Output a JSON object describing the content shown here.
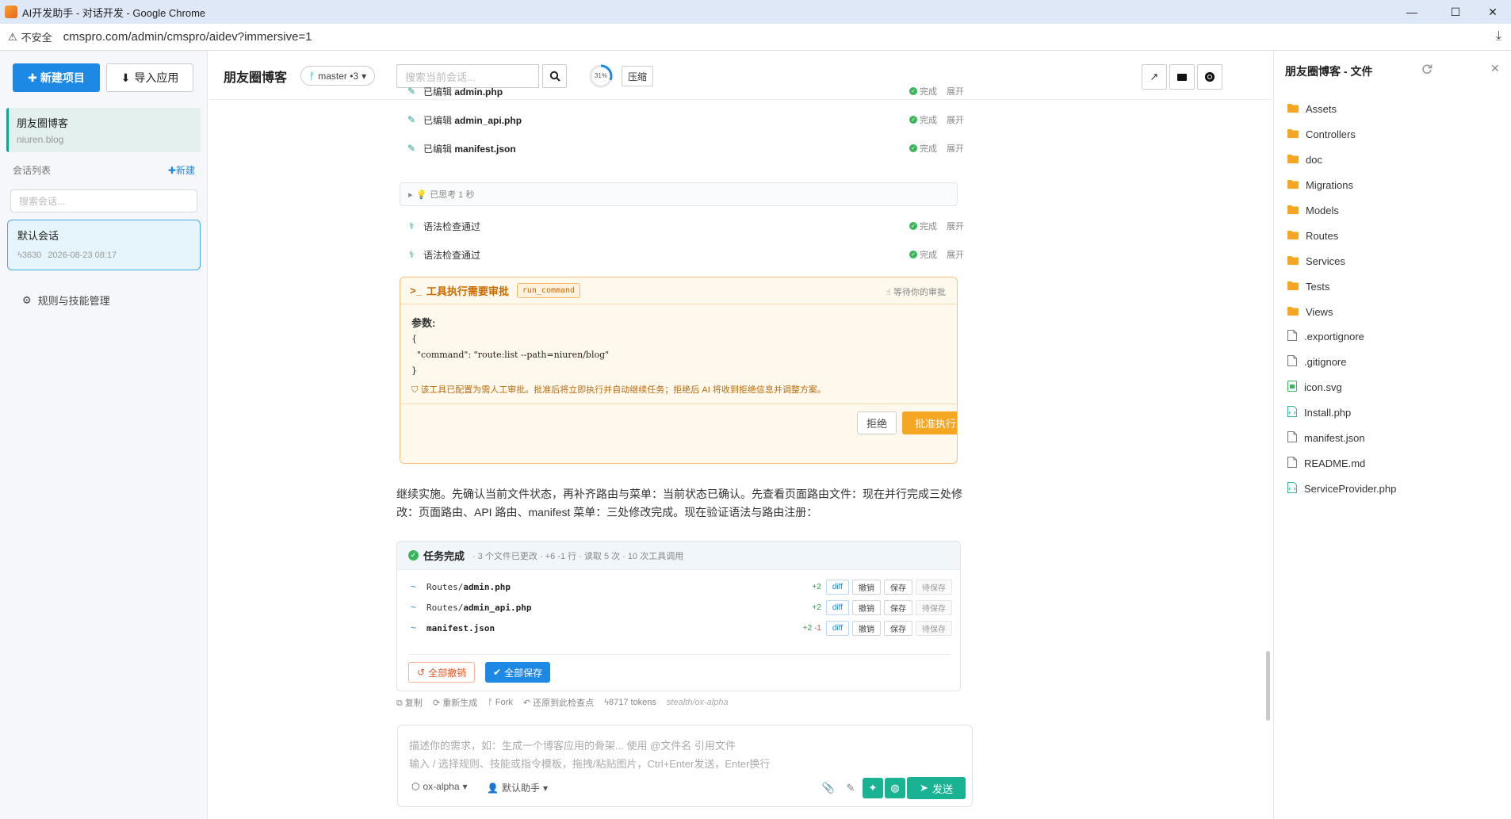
{
  "browser": {
    "title": "AI开发助手 - 对话开发 - Google Chrome",
    "security": "不安全",
    "url": "cmspro.com/admin/cmspro/aidev?immersive=1"
  },
  "sidebar": {
    "new_project": "新建项目",
    "import_app": "导入应用",
    "project": {
      "name": "朋友圈博客",
      "domain": "niuren.blog"
    },
    "conv_list_label": "会话列表",
    "conv_new": "新建",
    "conv_search_placeholder": "搜索会话...",
    "conversation": {
      "title": "默认会话",
      "tokens": "3630",
      "time": "2026-08-23 08:17"
    },
    "rules": "规则与技能管理"
  },
  "topbar": {
    "title": "朋友圈博客",
    "branch": "master •3",
    "search_placeholder": "搜索当前会话...",
    "context_usage": "31%",
    "context_usage_value": 0.31,
    "compress": "压缩"
  },
  "log": {
    "entries": [
      {
        "prefix": "已编辑",
        "file": "admin.php",
        "status": "完成",
        "expand": "展开"
      },
      {
        "prefix": "已编辑",
        "file": "admin_api.php",
        "status": "完成",
        "expand": "展开"
      },
      {
        "prefix": "已编辑",
        "file": "manifest.json",
        "status": "完成",
        "expand": "展开"
      }
    ],
    "thinking": "已思考 1 秒",
    "checks": [
      {
        "text": "语法检查通过",
        "status": "完成",
        "expand": "展开"
      },
      {
        "text": "语法检查通过",
        "status": "完成",
        "expand": "展开"
      }
    ]
  },
  "approval": {
    "title": "工具执行需要审批",
    "tool": "run_command",
    "waiting": "等待你的审批",
    "params_label": "参数:",
    "code_lines": [
      "{",
      "  \"command\": \"route:list --path=niuren/blog\"",
      "}"
    ],
    "note": "该工具已配置为需人工审批。批准后将立即执行并自动继续任务；拒绝后 AI 将收到拒绝信息并调整方案。",
    "reject": "拒绝",
    "approve": "批准执行"
  },
  "prose": {
    "text": "继续实施。先确认当前文件状态，再补齐路由与菜单：当前状态已确认。先查看页面路由文件：现在并行完成三处修改：页面路由、API 路由、manifest 菜单：三处修改完成。现在验证语法与路由注册："
  },
  "task": {
    "title": "任务完成",
    "meta": "· 3 个文件已更改 · +6 -1 行 · 读取 5 次 · 10 次工具调用",
    "files": [
      {
        "dir": "Routes/",
        "name": "admin.php",
        "add": "+2",
        "del": ""
      },
      {
        "dir": "Routes/",
        "name": "admin_api.php",
        "add": "+2",
        "del": ""
      },
      {
        "dir": "",
        "name": "manifest.json",
        "add": "+2",
        "del": "-1"
      }
    ],
    "btn_diff": "diff",
    "btn_undo": "撤销",
    "btn_save": "保存",
    "pending": "待保存",
    "undo_all": "全部撤销",
    "save_all": "全部保存"
  },
  "msg_actions": {
    "copy": "复制",
    "regenerate": "重新生成",
    "fork": "Fork",
    "restore": "还原到此检查点",
    "tokens": "8717 tokens",
    "model": "stealth/ox-alpha"
  },
  "composer": {
    "placeholder_line1": "描述你的需求，如：生成一个博客应用的骨架... 使用 @文件名 引用文件",
    "placeholder_line2": "输入 / 选择规则、技能或指令模板，拖拽/粘贴图片，Ctrl+Enter发送，Enter换行",
    "model": "ox-alpha",
    "agent": "默认助手",
    "send": "发送"
  },
  "files_panel": {
    "title": "朋友圈博客 - 文件",
    "items": [
      {
        "name": "Assets",
        "type": "folder"
      },
      {
        "name": "Controllers",
        "type": "folder"
      },
      {
        "name": "doc",
        "type": "folder"
      },
      {
        "name": "Migrations",
        "type": "folder"
      },
      {
        "name": "Models",
        "type": "folder"
      },
      {
        "name": "Routes",
        "type": "folder"
      },
      {
        "name": "Services",
        "type": "folder"
      },
      {
        "name": "Tests",
        "type": "folder"
      },
      {
        "name": "Views",
        "type": "folder"
      },
      {
        "name": ".exportignore",
        "type": "file"
      },
      {
        "name": ".gitignore",
        "type": "file"
      },
      {
        "name": "icon.svg",
        "type": "image"
      },
      {
        "name": "Install.php",
        "type": "code"
      },
      {
        "name": "manifest.json",
        "type": "file"
      },
      {
        "name": "README.md",
        "type": "file"
      },
      {
        "name": "ServiceProvider.php",
        "type": "code"
      }
    ]
  },
  "colors": {
    "primary": "#1e88e5",
    "accent": "#19b394",
    "warning": "#f5a623",
    "success": "#3bb55c"
  }
}
